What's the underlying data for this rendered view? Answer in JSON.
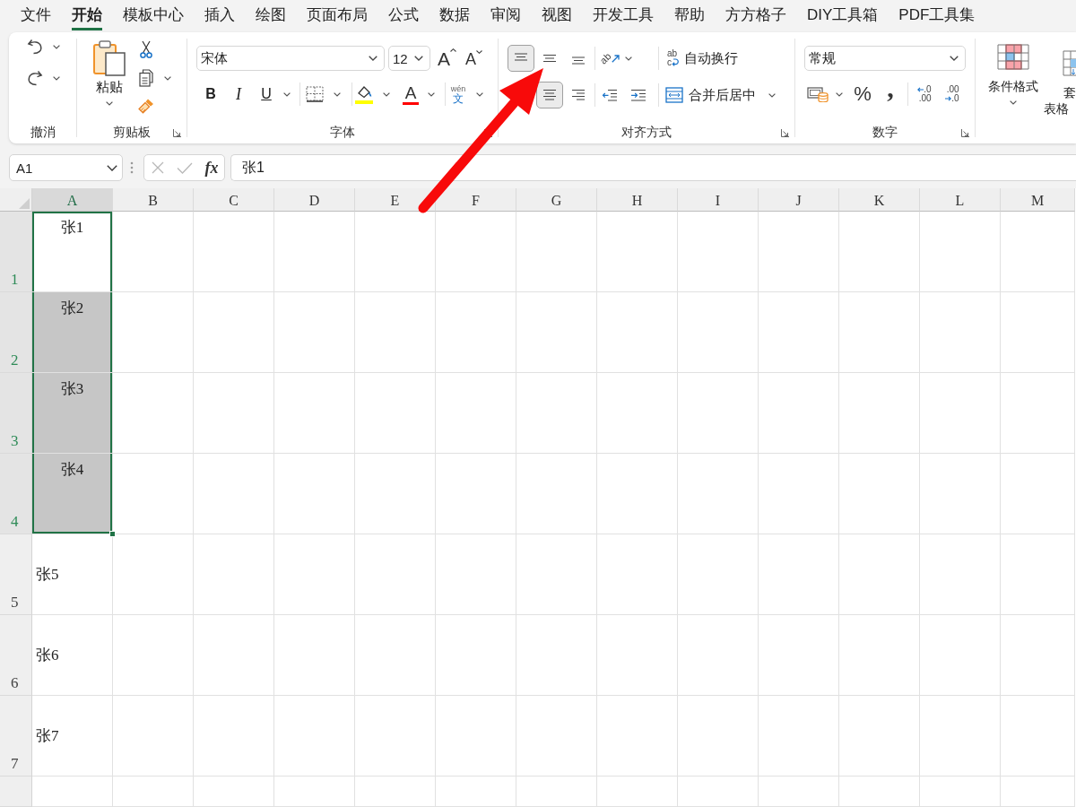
{
  "menu_tabs": [
    {
      "label": "文件",
      "selected": false
    },
    {
      "label": "开始",
      "selected": true
    },
    {
      "label": "模板中心",
      "selected": false
    },
    {
      "label": "插入",
      "selected": false
    },
    {
      "label": "绘图",
      "selected": false
    },
    {
      "label": "页面布局",
      "selected": false
    },
    {
      "label": "公式",
      "selected": false
    },
    {
      "label": "数据",
      "selected": false
    },
    {
      "label": "审阅",
      "selected": false
    },
    {
      "label": "视图",
      "selected": false
    },
    {
      "label": "开发工具",
      "selected": false
    },
    {
      "label": "帮助",
      "selected": false
    },
    {
      "label": "方方格子",
      "selected": false
    },
    {
      "label": "DIY工具箱",
      "selected": false
    },
    {
      "label": "PDF工具集",
      "selected": false
    }
  ],
  "ribbon": {
    "undo_group": {
      "label": "撤消"
    },
    "clipboard_group": {
      "label": "剪贴板",
      "paste_label": "粘贴"
    },
    "font_group": {
      "label": "字体",
      "font_name": "宋体",
      "font_size": "12",
      "grow_font": "A",
      "shrink_font": "A",
      "bold": "B",
      "italic": "I",
      "underline": "U",
      "font_color": "A",
      "phonetic_top": "wén",
      "phonetic_bottom": "文"
    },
    "alignment_group": {
      "label": "对齐方式",
      "vertical_align": [
        {
          "selected": true
        },
        {
          "selected": false
        },
        {
          "selected": false
        }
      ],
      "horizontal_align": [
        {
          "selected": true
        },
        {
          "selected": false
        }
      ],
      "orientation_glyph": "ab",
      "wrap_glyph_top": "ab",
      "wrap_glyph_bottom": "c",
      "wrap_text": "自动换行",
      "merge_center": "合并后居中"
    },
    "number_group": {
      "label": "数字",
      "format": "常规",
      "percent": "%",
      "comma": ",",
      "increase_decimal": [
        ".0",
        ".00"
      ],
      "decrease_decimal": [
        ".00",
        ".0"
      ]
    },
    "styles_group": {
      "conditional_format": "条件格式",
      "table_format_top": "套",
      "table_format_bottom": "表格"
    }
  },
  "formula_bar": {
    "name_box": "A1",
    "cancel_button": {
      "disabled": true
    },
    "enter_button": {
      "disabled": true
    },
    "function_button": "fx",
    "formula": "张1"
  },
  "sheet": {
    "columns": [
      {
        "label": "A",
        "selected": true
      },
      {
        "label": "B",
        "selected": false
      },
      {
        "label": "C",
        "selected": false
      },
      {
        "label": "D",
        "selected": false
      },
      {
        "label": "E",
        "selected": false
      },
      {
        "label": "F",
        "selected": false
      },
      {
        "label": "G",
        "selected": false
      },
      {
        "label": "H",
        "selected": false
      },
      {
        "label": "I",
        "selected": false
      },
      {
        "label": "J",
        "selected": false
      },
      {
        "label": "K",
        "selected": false
      },
      {
        "label": "L",
        "selected": false
      },
      {
        "label": "M",
        "selected": false
      }
    ],
    "rows": [
      {
        "number": "1",
        "selected": true,
        "cell": {
          "text": "张1",
          "kind": "centered",
          "selected": true,
          "active": true
        }
      },
      {
        "number": "2",
        "selected": true,
        "cell": {
          "text": "张2",
          "kind": "centered",
          "selected": true,
          "active": false
        }
      },
      {
        "number": "3",
        "selected": true,
        "cell": {
          "text": "张3",
          "kind": "centered",
          "selected": true,
          "active": false
        }
      },
      {
        "number": "4",
        "selected": true,
        "cell": {
          "text": "张4",
          "kind": "centered",
          "selected": true,
          "active": false
        }
      },
      {
        "number": "5",
        "selected": false,
        "cell": {
          "text": "张5",
          "kind": "plain",
          "selected": false,
          "active": false
        }
      },
      {
        "number": "6",
        "selected": false,
        "cell": {
          "text": "张6",
          "kind": "plain",
          "selected": false,
          "active": false
        }
      },
      {
        "number": "7",
        "selected": false,
        "cell": {
          "text": "张7",
          "kind": "plain",
          "selected": false,
          "active": false
        }
      }
    ]
  }
}
